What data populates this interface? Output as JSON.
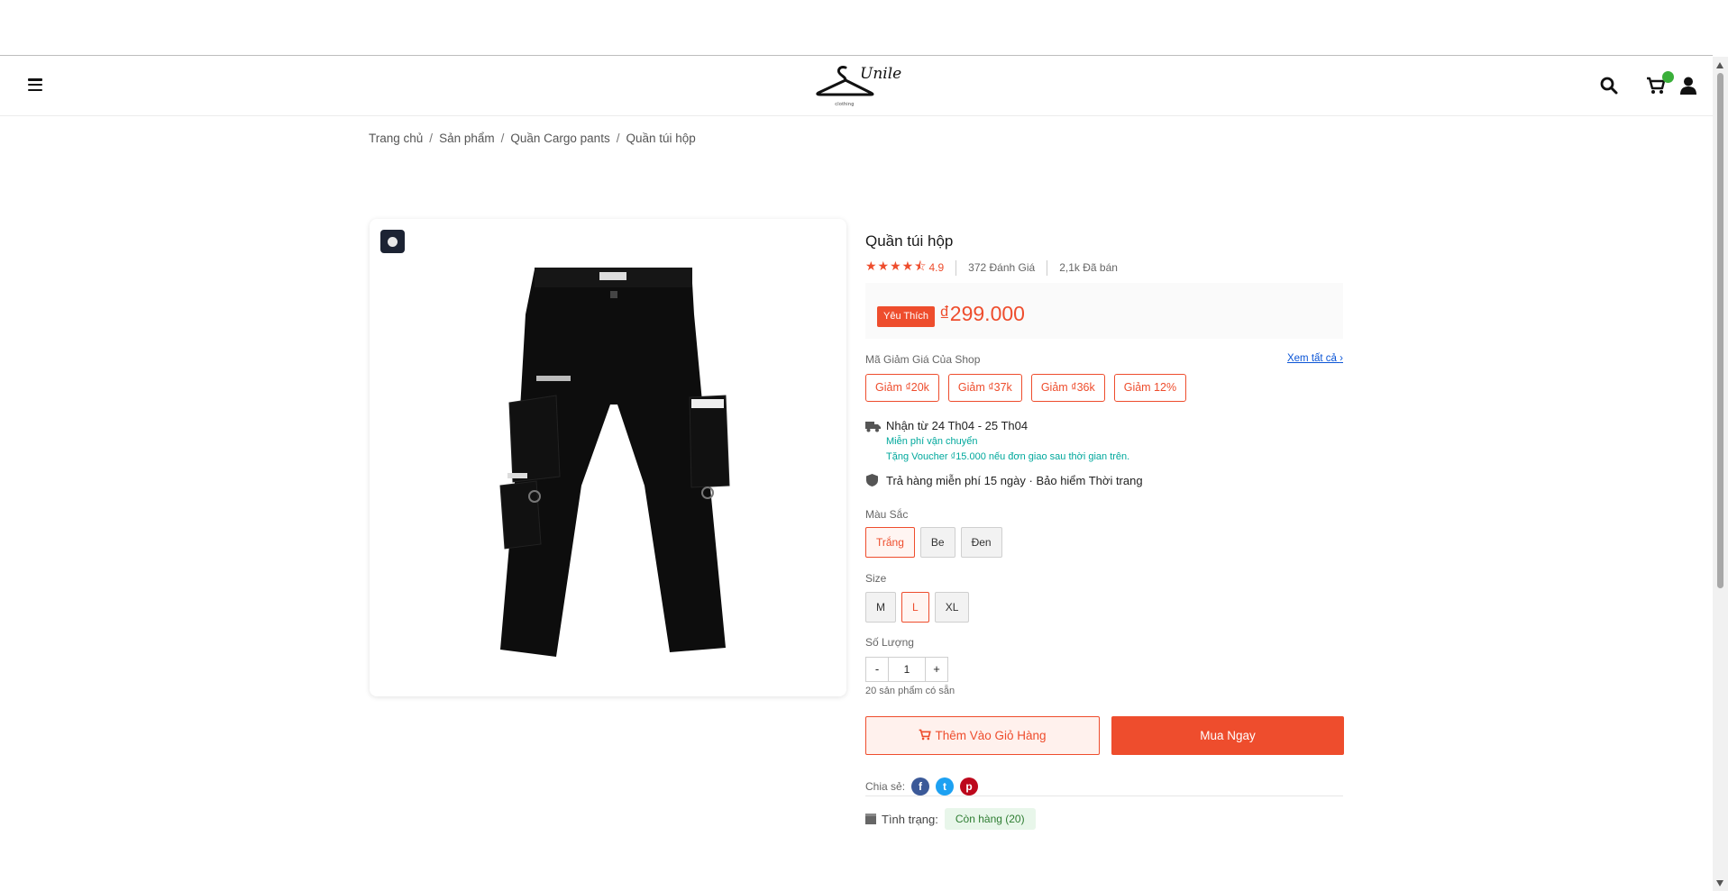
{
  "header": {
    "menu_icon": "hamburger-icon",
    "logo_word": "Unile",
    "logo_sub": "clothing",
    "icons": [
      "search-icon",
      "cart-icon",
      "user-icon"
    ]
  },
  "breadcrumb": [
    "Trang chủ",
    "Sản phẩm",
    "Quần Cargo pants",
    "Quần túi hộp"
  ],
  "product": {
    "title": "Quần túi hộp",
    "stars": "★★★★⯪",
    "rating": "4.9",
    "reviews": "372 Đánh Giá",
    "sold": "2,1k Đã bán",
    "fav_tag": "Yêu Thích",
    "price": "₫299.000"
  },
  "vouchers": {
    "title": "Mã Giảm Giá Của Shop",
    "see_all": "Xem tất cả",
    "items": [
      "Giảm ₫20k",
      "Giảm ₫37k",
      "Giảm ₫36k",
      "Giảm 12%"
    ]
  },
  "shipping": {
    "delivery": "Nhận từ 24 Th04 - 25 Th04",
    "free_ship": "Miễn phí vận chuyển",
    "voucher_note": "Tặng Voucher ₫15.000 nếu đơn giao sau thời gian trên.",
    "returns": "Trả hàng miễn phí 15 ngày · Bảo hiểm Thời trang"
  },
  "options": {
    "color_label": "Màu Sắc",
    "colors": [
      "Trắng",
      "Be",
      "Đen"
    ],
    "size_label": "Size",
    "sizes": [
      "M",
      "L",
      "XL"
    ],
    "qty_label": "Số Lượng",
    "qty_minus": "-",
    "qty_value": "1",
    "qty_plus": "+",
    "stock_note": "20 sản phẩm có sẵn"
  },
  "actions": {
    "add_to_cart": "Thêm Vào Giỏ Hàng",
    "buy_now": "Mua Ngay"
  },
  "share": {
    "label": "Chia sẻ:",
    "facebook": "f",
    "twitter": "t",
    "pinterest": "p"
  },
  "status": {
    "label": "Tình trạng:",
    "badge": "Còn hàng (20)"
  },
  "colors": {
    "accent": "#ee4d2d",
    "green": "#00a89c",
    "facebook": "#3b5998",
    "twitter": "#1da1f2",
    "pinterest": "#bd081c"
  }
}
